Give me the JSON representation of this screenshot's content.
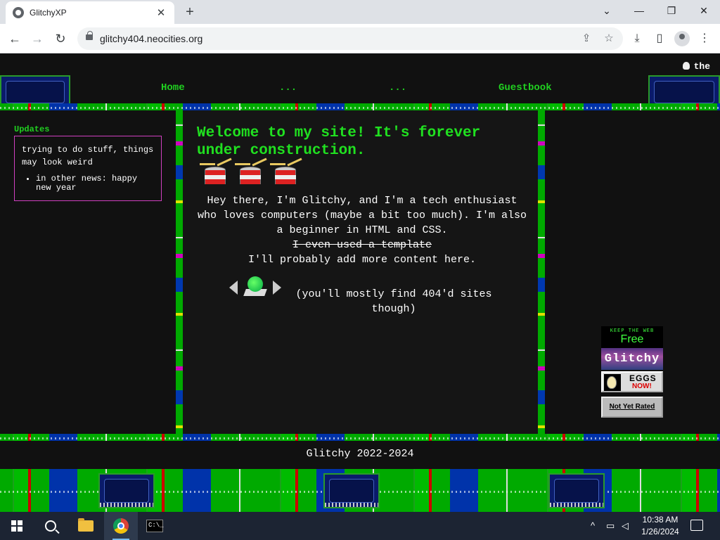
{
  "browser": {
    "tab_title": "GlitchyXP",
    "tab_close": "✕",
    "new_tab": "+",
    "window_minimize": "—",
    "window_restore": "❐",
    "window_close": "✕",
    "window_dropdown": "⌄",
    "back": "←",
    "forward": "→",
    "reload": "↻",
    "url": "glitchy404.neocities.org",
    "share": "⇪",
    "bookmark": "☆",
    "download": "⤓",
    "sidepanel": "▯",
    "menu": "⋮"
  },
  "site": {
    "nav": [
      "Home",
      "...",
      "...",
      "Guestbook"
    ],
    "top_right": "the",
    "updates": {
      "title": "Updates",
      "text": "trying to do stuff, things may look weird",
      "items": [
        "in other news: happy new year"
      ]
    },
    "welcome": "Welcome to my site! It's forever under construction.",
    "bio_line1": "Hey there, I'm Glitchy, and I'm a tech enthusiast who loves computers (maybe a bit too much). I'm also a beginner in HTML and CSS.",
    "bio_strike": "I even used a template",
    "bio_line2": "I'll probably add more content here.",
    "webring_note": "(you'll mostly find 404'd sites though)",
    "buttons": {
      "free_small": "KEEP THE WEB",
      "free_big": "Free",
      "glitchy": "Glitchy",
      "eggs": "EGGS",
      "now": "NOW!",
      "not_rated": "Not Yet Rated"
    },
    "footer": "Glitchy 2022-2024"
  },
  "taskbar": {
    "time": "10:38 AM",
    "date": "1/26/2024",
    "cmd_text": "C:\\_"
  }
}
